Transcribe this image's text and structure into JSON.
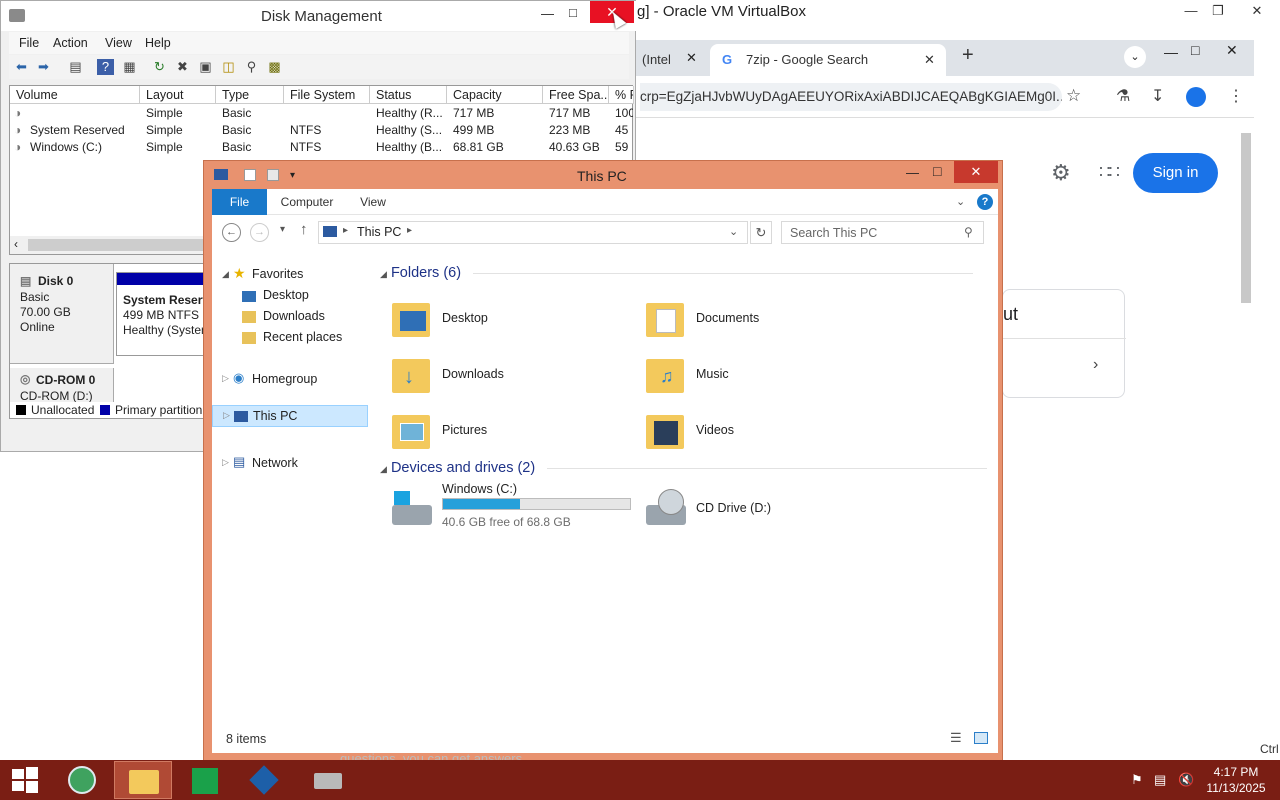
{
  "virtualbox": {
    "title": "g] - Oracle VM VirtualBox"
  },
  "chrome": {
    "tabs": [
      {
        "label": "(Intel"
      },
      {
        "label": "7zip - Google Search"
      }
    ],
    "url": "crp=EgZjaHJvbWUyDAgAEEUYORixAxiABDIJCAEQABgKGIAEMg0I...",
    "sign_in": "Sign in",
    "card_text": "ut",
    "partial_footer": "questions, you can get answers ..."
  },
  "disk_mgmt": {
    "title": "Disk Management",
    "menu": [
      "File",
      "Action",
      "View",
      "Help"
    ],
    "columns": [
      "Volume",
      "Layout",
      "Type",
      "File System",
      "Status",
      "Capacity",
      "Free Spa...",
      "% F"
    ],
    "rows": [
      {
        "volume": "",
        "layout": "Simple",
        "type": "Basic",
        "fs": "",
        "status": "Healthy (R...",
        "capacity": "717 MB",
        "free": "717 MB",
        "pct": "100"
      },
      {
        "volume": "System Reserved",
        "layout": "Simple",
        "type": "Basic",
        "fs": "NTFS",
        "status": "Healthy (S...",
        "capacity": "499 MB",
        "free": "223 MB",
        "pct": "45"
      },
      {
        "volume": "Windows (C:)",
        "layout": "Simple",
        "type": "Basic",
        "fs": "NTFS",
        "status": "Healthy (B...",
        "capacity": "68.81 GB",
        "free": "40.63 GB",
        "pct": "59"
      }
    ],
    "disk0": {
      "name": "Disk 0",
      "type": "Basic",
      "size": "70.00 GB",
      "state": "Online"
    },
    "partition": {
      "name": "System Reserv",
      "size": "499 MB NTFS",
      "status": "Healthy (Systen"
    },
    "cdrom": {
      "name": "CD-ROM 0",
      "sub": "CD-ROM (D:)"
    },
    "legend": {
      "unalloc": "Unallocated",
      "primary": "Primary partition"
    }
  },
  "explorer": {
    "title": "This PC",
    "ribbon_tabs": [
      "File",
      "Computer",
      "View"
    ],
    "breadcrumb": "This PC",
    "search_placeholder": "Search This PC",
    "nav": {
      "favorites": "Favorites",
      "fav_items": [
        "Desktop",
        "Downloads",
        "Recent places"
      ],
      "homegroup": "Homegroup",
      "thispc": "This PC",
      "network": "Network"
    },
    "folders_header": "Folders (6)",
    "folders": [
      "Desktop",
      "Documents",
      "Downloads",
      "Music",
      "Pictures",
      "Videos"
    ],
    "drives_header": "Devices and drives (2)",
    "drive_c": {
      "name": "Windows (C:)",
      "free_text": "40.6 GB free of 68.8 GB",
      "used_fraction": 0.41
    },
    "drive_d": {
      "name": "CD Drive (D:)"
    },
    "status": "8 items"
  },
  "tray": {
    "time": "4:17 PM",
    "date": "11/13/2025",
    "ctrl": "Ctrl"
  },
  "colors": {
    "explorer_frame": "#e8926f",
    "taskbar": "#7a1e14",
    "accent": "#1979ca",
    "close_red": "#e81123"
  }
}
